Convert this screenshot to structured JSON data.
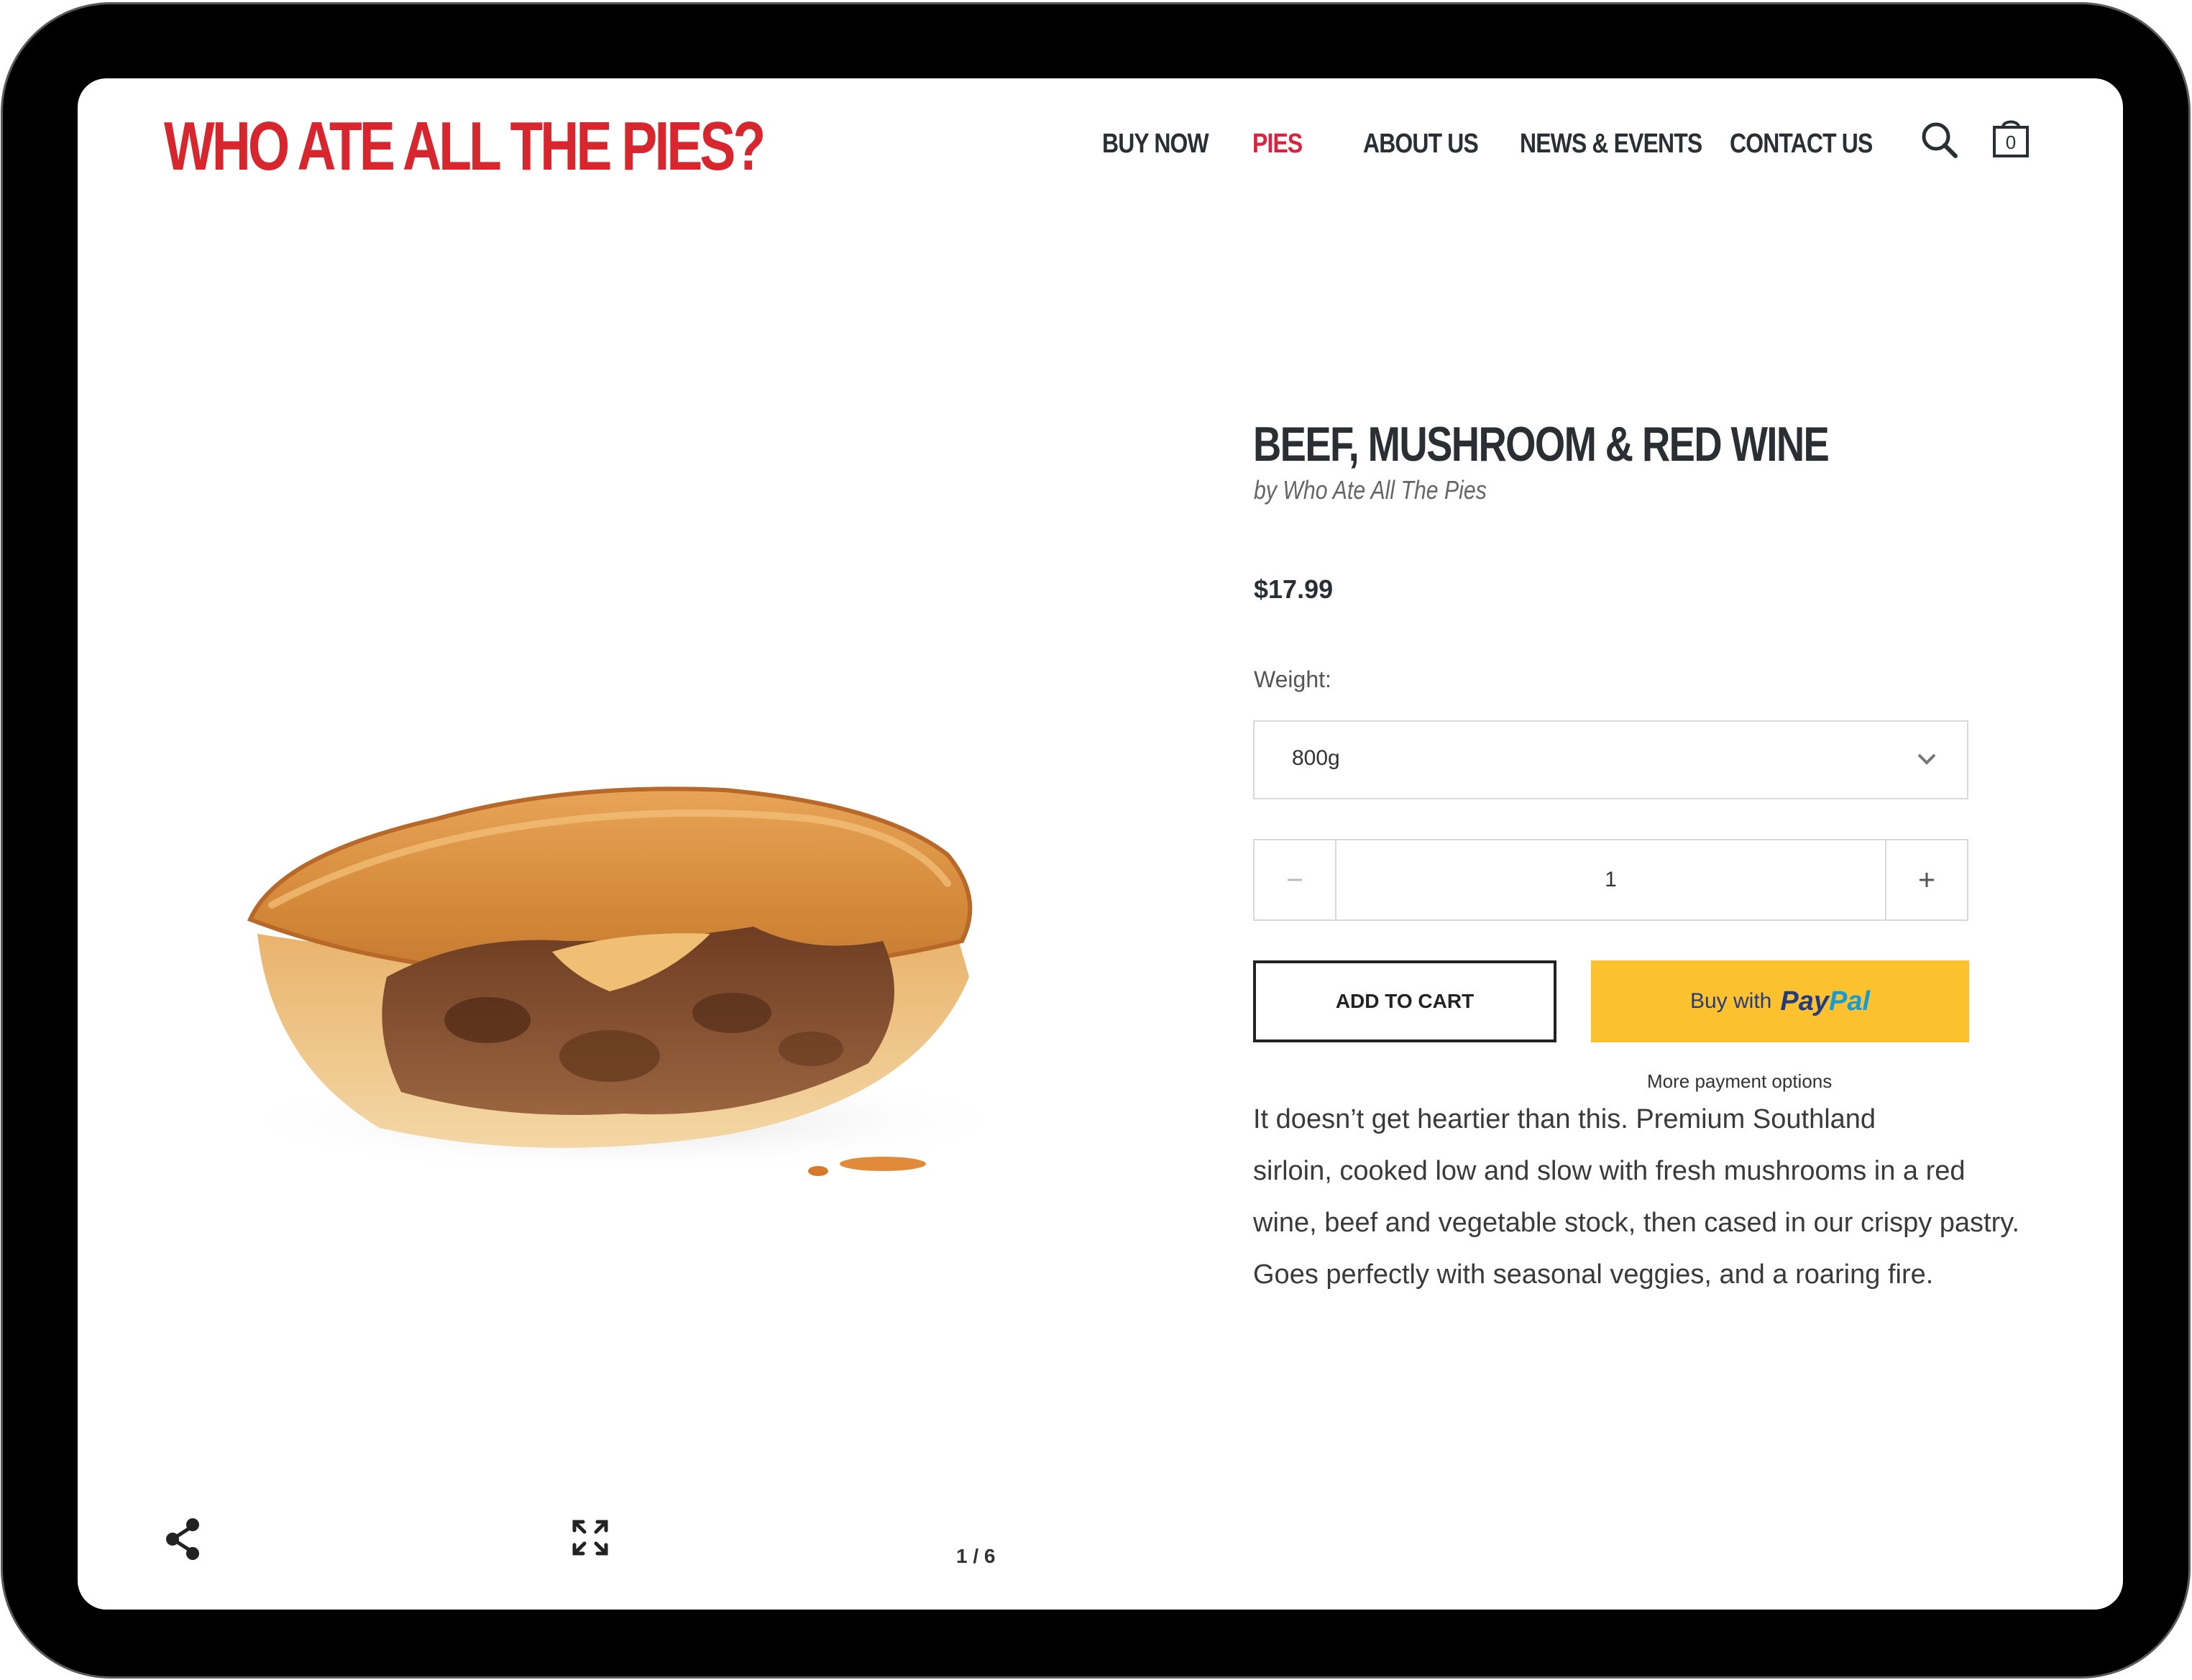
{
  "header": {
    "logo_text": "WHO ATE ALL THE PIES?",
    "nav": [
      {
        "label": "BUY NOW",
        "active": false
      },
      {
        "label": "PIES",
        "active": true
      },
      {
        "label": "ABOUT US",
        "active": false
      },
      {
        "label": "NEWS & EVENTS",
        "active": false
      },
      {
        "label": "CONTACT US",
        "active": false
      }
    ],
    "cart_count": "0"
  },
  "product": {
    "title": "BEEF, MUSHROOM & RED WINE",
    "vendor": "by Who Ate All The Pies",
    "price": "$17.99",
    "weight_label": "Weight:",
    "weight_value": "800g",
    "quantity": "1",
    "add_to_cart": "ADD TO CART",
    "paypal_prefix": "Buy with",
    "paypal_brand_pay": "Pay",
    "paypal_brand_pal": "Pal",
    "more_payment_options": "More payment options",
    "description_lines": [
      "It doesn’t get heartier than this. Premium Southland",
      "sirloin, cooked low and slow with fresh mushrooms in a red",
      "wine, beef and vegetable stock, then cased in our crispy pastry.",
      "Goes perfectly with seasonal veggies, and a roaring fire."
    ]
  },
  "gallery": {
    "image_alt": "pie-image",
    "counter": "1 / 6",
    "share_icon": "share-icon",
    "expand_icon": "expand-icon"
  },
  "colors": {
    "brand_red": "#d7262e",
    "nav_active": "#e0203f",
    "text_dark": "#2b2f33",
    "paypal_yellow": "#fcc12f",
    "paypal_blue_dark": "#253b80",
    "paypal_blue_light": "#179bd7",
    "bezel": "#000000"
  }
}
